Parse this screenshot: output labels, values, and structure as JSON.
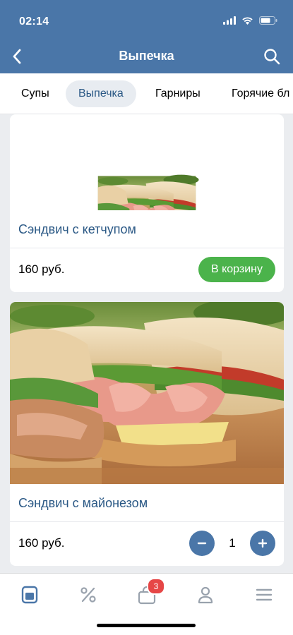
{
  "status_bar": {
    "time": "02:14"
  },
  "header": {
    "title": "Выпечка"
  },
  "tabs": [
    {
      "label": "Супы",
      "active": false
    },
    {
      "label": "Выпечка",
      "active": true
    },
    {
      "label": "Гарниры",
      "active": false
    },
    {
      "label": "Горячие бл",
      "active": false
    }
  ],
  "products": [
    {
      "name": "Сэндвич с кетчупом",
      "price": "160 руб.",
      "action_label": "В корзину"
    },
    {
      "name": "Сэндвич с майонезом",
      "price": "160 руб.",
      "quantity": "1"
    }
  ],
  "bottom_nav": {
    "items": [
      "catalog-icon",
      "percent-icon",
      "cart-icon",
      "profile-icon",
      "menu-icon"
    ],
    "cart_badge": "3"
  },
  "colors": {
    "accent": "#4a76a8",
    "link": "#2a5885",
    "cart_button": "#4bb34b",
    "badge": "#e64646"
  }
}
